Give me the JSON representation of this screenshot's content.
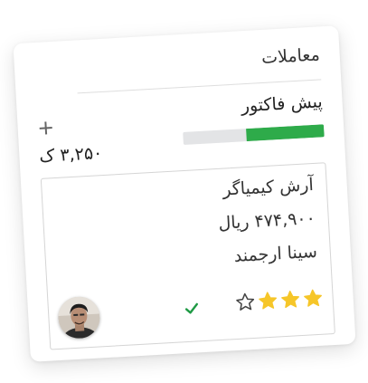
{
  "card": {
    "title": "معاملات",
    "stage_name": "پیش فاکتور",
    "total_amount": "۳,۲۵۰ ک",
    "progress_fraction": 0.55
  },
  "deal": {
    "name": "آرش کیمیاگر",
    "amount": "۴۷۴,۹۰۰ ریال",
    "contact": "سینا ارجمند",
    "rating": 3,
    "rating_max": 4
  },
  "colors": {
    "progress": "#2eab4a",
    "progress_track": "#e3e4e6",
    "star_filled": "#f6c629",
    "check": "#1f9a45"
  },
  "icons": {
    "add": "plus-icon",
    "status": "check-icon",
    "rating": "star-icon"
  }
}
